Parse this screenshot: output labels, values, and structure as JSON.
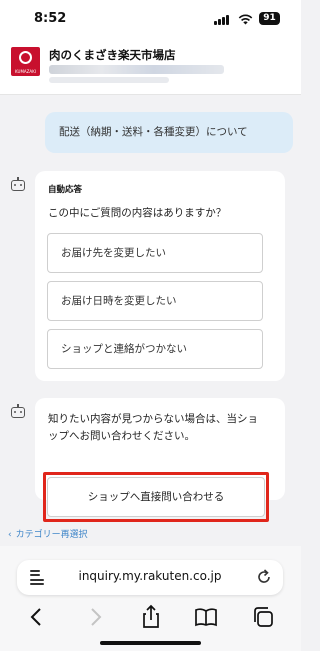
{
  "status": {
    "time": "8:52",
    "battery": "91"
  },
  "shop": {
    "name": "肉のくまざき楽天市場店"
  },
  "chat": {
    "user_message": "配送（納期・送料・各種変更）について",
    "auto_reply_label": "自動応答",
    "question": "この中にご質問の内容はありますか？",
    "options": [
      {
        "label": "お届け先を変更したい"
      },
      {
        "label": "お届け日時を変更したい"
      },
      {
        "label": "ショップと連絡がつかない"
      }
    ],
    "not_found_text": "知りたい内容が見つからない場合は、当ショップへお問い合わせください。",
    "contact_button": "ショップへ直接問い合わせる",
    "highlight_color": "#e0261b",
    "reselect_link": "カテゴリー再選択"
  },
  "browser": {
    "url": "inquiry.my.rakuten.co.jp"
  },
  "icons": {
    "status": [
      "signal-icon",
      "wifi-icon",
      "battery-icon"
    ],
    "chat": [
      "bot-icon"
    ],
    "toolbar": [
      "back-icon",
      "forward-icon",
      "share-icon",
      "bookmarks-icon",
      "tabs-icon"
    ]
  },
  "colors": {
    "accent_link": "#3f86c9",
    "user_bubble": "#dcecf8",
    "brand_red": "#c8102e"
  }
}
